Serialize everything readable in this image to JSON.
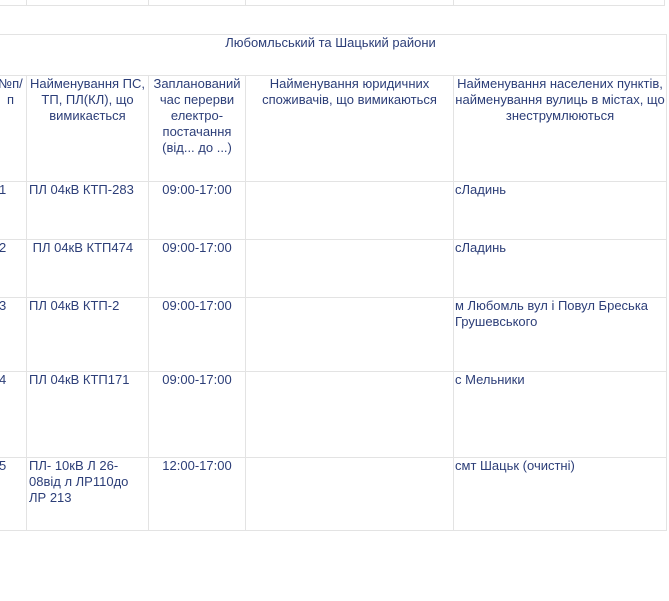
{
  "region_title": "Любомльський та Шацький райони",
  "columns": {
    "num": "№п/п",
    "line": "Найменування ПС, ТП, ПЛ(КЛ), що вимикається",
    "time": "Запланований час перерви електро-постачання (від... до ...)",
    "consumers": "Найменування юридичних споживачів, що вимикаються",
    "places": "Найменування населених пунктів, найменування вулиць в містах, що знеструмлюються"
  },
  "rows": [
    {
      "num": "1",
      "line": "ПЛ 04кВ КТП-283",
      "time": "09:00-17:00",
      "consumers": "",
      "places": "сЛадинь"
    },
    {
      "num": "2",
      "line": " ПЛ 04кВ КТП474",
      "time": "09:00-17:00",
      "consumers": "",
      "places": "сЛадинь"
    },
    {
      "num": "3",
      "line": "ПЛ 04кВ КТП-2",
      "time": "09:00-17:00",
      "consumers": "",
      "places": "м Любомль вул і Повул Бреська Грушевського"
    },
    {
      "num": "4",
      "line": "ПЛ 04кВ КТП171",
      "time": "09:00-17:00",
      "consumers": "",
      "places": "с Мельники"
    },
    {
      "num": "5",
      "line": "ПЛ- 10кВ Л 26-08від л ЛР110до ЛР 213",
      "time": "12:00-17:00",
      "consumers": "",
      "places": "смт Шацьк (очистні)"
    }
  ]
}
